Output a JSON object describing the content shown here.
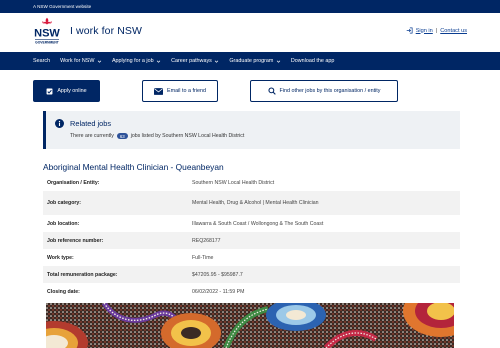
{
  "topbar": {
    "text": "A NSW Government website"
  },
  "header": {
    "logo_text": "NSW",
    "logo_subtext": "GOVERNMENT",
    "site_title": "I work for NSW",
    "sign_in": "Sign in",
    "separator": "|",
    "contact_us": "Contact us"
  },
  "nav": {
    "items": [
      {
        "label": "Search"
      },
      {
        "label": "Work for NSW"
      },
      {
        "label": "Applying for a job"
      },
      {
        "label": "Career pathways"
      },
      {
        "label": "Graduate program"
      },
      {
        "label": "Download the app"
      }
    ]
  },
  "actions": {
    "apply": "Apply online",
    "email": "Email to a friend",
    "find": "Find other jobs by this organisation / entity"
  },
  "related": {
    "title": "Related jobs",
    "prefix": "There are currently",
    "count": "63",
    "suffix": "jobs listed by Southern NSW Local Health District"
  },
  "job": {
    "title": "Aboriginal Mental Health Clinician - Queanbeyan",
    "details": [
      {
        "label": "Organisation / Entity:",
        "value": "Southern NSW Local Health District"
      },
      {
        "label": "Job category:",
        "value": "Mental Health, Drug & Alcohol | Mental Health Clinician"
      },
      {
        "label": "Job location:",
        "value": "Illawarra & South Coast / Wollongong & The South Coast"
      },
      {
        "label": "Job reference number:",
        "value": "REQ268177"
      },
      {
        "label": "Work type:",
        "value": "Full-Time"
      },
      {
        "label": "Total remuneration package:",
        "value": "$47205.95 - $95987.7"
      },
      {
        "label": "Closing date:",
        "value": "06/02/2022 - 11:59 PM"
      }
    ]
  },
  "colors": {
    "brand_navy": "#002664",
    "link_blue": "#0a3d91",
    "nsw_red": "#d7153a",
    "badge_blue": "#2e5299"
  }
}
